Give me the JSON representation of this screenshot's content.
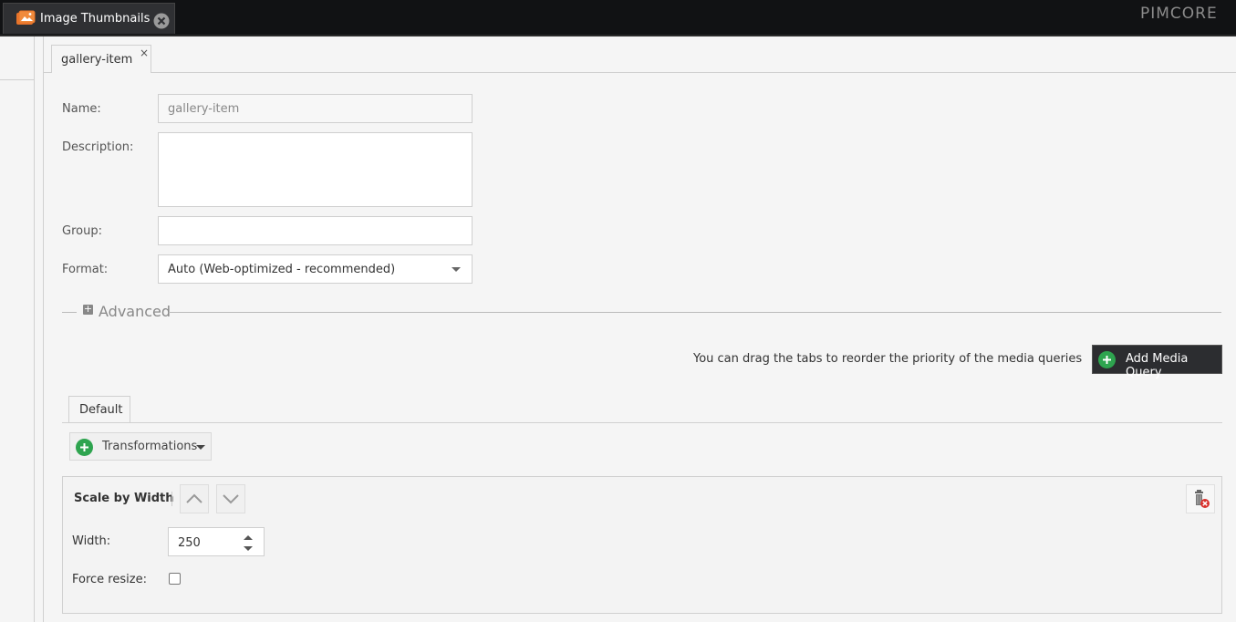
{
  "topbar": {
    "tab_label": "Image Thumbnails",
    "logo": "PIMCORE"
  },
  "editor": {
    "tab_label": "gallery-item",
    "tab_close": "×"
  },
  "form": {
    "name_label": "Name:",
    "name_value": "gallery-item",
    "description_label": "Description:",
    "description_value": "",
    "group_label": "Group:",
    "group_value": "",
    "format_label": "Format:",
    "format_value": "Auto (Web-optimized - recommended)"
  },
  "advanced": {
    "label": "Advanced",
    "toggle": "+"
  },
  "media": {
    "hint": "You can drag the tabs to reorder the priority of the media queries",
    "add_button": "Add Media Query",
    "default_tab": "Default",
    "transformations_button": "Transformations"
  },
  "transformation": {
    "title": "Scale by Width",
    "width_label": "Width:",
    "width_value": "250",
    "force_resize_label": "Force resize:",
    "force_resize_checked": false
  },
  "icons": {
    "tab_icon": "image-thumbnails-icon",
    "close": "close-icon",
    "plus": "plus-circle-icon",
    "trash": "trash-delete-icon"
  },
  "colors": {
    "topbar_bg": "#111214",
    "accent_orange": "#e8742a",
    "add_green": "#2ea44f"
  }
}
